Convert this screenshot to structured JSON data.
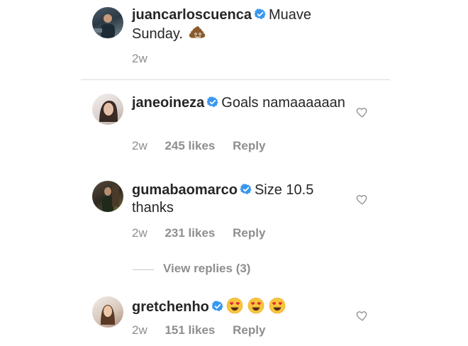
{
  "comments": [
    {
      "username": "juancarloscuenca",
      "text": "Muave Sunday.",
      "time": "2w",
      "emoji": "poop-emoji"
    },
    {
      "username": "janeoineza",
      "text": "Goals namaaaaaan",
      "time": "2w",
      "likes": "245 likes",
      "reply": "Reply"
    },
    {
      "username": "gumabaomarco",
      "text": "Size 10.5 thanks",
      "time": "2w",
      "likes": "231 likes",
      "reply": "Reply",
      "view_replies": "View replies (3)"
    },
    {
      "username": "gretchenho",
      "text": "",
      "time": "2w",
      "likes": "151 likes",
      "reply": "Reply",
      "emojis": [
        "heart-eyes-emoji",
        "heart-eyes-emoji",
        "heart-eyes-emoji"
      ]
    }
  ],
  "colors": {
    "verified": "#3897f0",
    "muted": "#8e8e8e",
    "text": "#262626"
  }
}
